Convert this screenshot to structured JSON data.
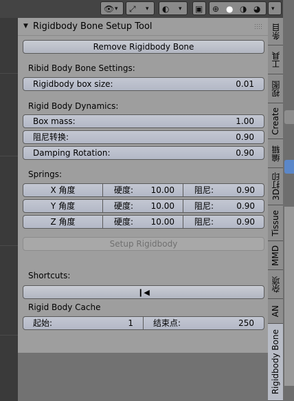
{
  "panel": {
    "title": "Rigidbody Bone Setup Tool",
    "remove_button": "Remove Rigidbody Bone",
    "settings_header": "Ribid Body Bone Settings:",
    "box_size": {
      "label": "Rigidbody box size:",
      "value": "0.01"
    },
    "dynamics_header": "Rigid Body Dynamics:",
    "box_mass": {
      "label": "Box mass:",
      "value": "1.00"
    },
    "damping": {
      "label": "阻尼转换:",
      "value": "0.90"
    },
    "damping_rotation": {
      "label": "Damping Rotation:",
      "value": "0.90"
    },
    "springs_header": "Springs:",
    "springs": [
      {
        "axis": "X 角度",
        "stiff_label": "硬度:",
        "stiff_value": "10.00",
        "damp_label": "阻尼:",
        "damp_value": "0.90"
      },
      {
        "axis": "Y 角度",
        "stiff_label": "硬度:",
        "stiff_value": "10.00",
        "damp_label": "阻尼:",
        "damp_value": "0.90"
      },
      {
        "axis": "Z 角度",
        "stiff_label": "硬度:",
        "stiff_value": "10.00",
        "damp_label": "阻尼:",
        "damp_value": "0.90"
      }
    ],
    "setup_button": "Setup Rigidbody",
    "shortcuts_header": "Shortcuts:",
    "shortcut_icon": "skip-to-start-icon",
    "cache_header": "Rigid Body Cache",
    "cache_start": {
      "label": "起始:",
      "value": "1"
    },
    "cache_end": {
      "label": "结束点:",
      "value": "250"
    }
  },
  "tabs": [
    "条目",
    "工具",
    "视图",
    "Create",
    "编辑",
    "3D打印",
    "Tissue",
    "MMD",
    "杂项",
    "AN",
    "Rigidbody Bone"
  ],
  "active_tab": "Rigidbody Bone"
}
